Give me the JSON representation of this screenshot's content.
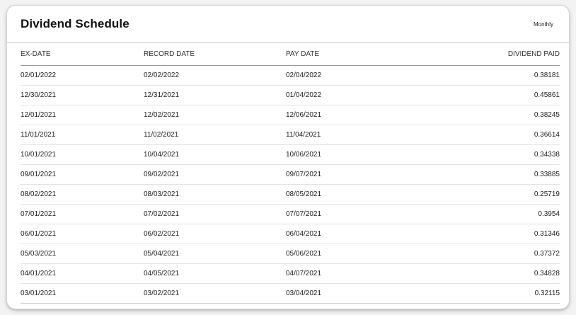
{
  "card": {
    "title": "Dividend Schedule",
    "frequency": "Monthly"
  },
  "table": {
    "headers": [
      "EX-DATE",
      "RECORD DATE",
      "PAY DATE",
      "DIVIDEND PAID"
    ],
    "rows": [
      [
        "02/01/2022",
        "02/02/2022",
        "02/04/2022",
        "0.38181"
      ],
      [
        "12/30/2021",
        "12/31/2021",
        "01/04/2022",
        "0.45861"
      ],
      [
        "12/01/2021",
        "12/02/2021",
        "12/06/2021",
        "0.38245"
      ],
      [
        "11/01/2021",
        "11/02/2021",
        "11/04/2021",
        "0.36614"
      ],
      [
        "10/01/2021",
        "10/04/2021",
        "10/06/2021",
        "0.34338"
      ],
      [
        "09/01/2021",
        "09/02/2021",
        "09/07/2021",
        "0.33885"
      ],
      [
        "08/02/2021",
        "08/03/2021",
        "08/05/2021",
        "0.25719"
      ],
      [
        "07/01/2021",
        "07/02/2021",
        "07/07/2021",
        "0.3954"
      ],
      [
        "06/01/2021",
        "06/02/2021",
        "06/04/2021",
        "0.31346"
      ],
      [
        "05/03/2021",
        "05/04/2021",
        "05/06/2021",
        "0.37372"
      ],
      [
        "04/01/2021",
        "04/05/2021",
        "04/07/2021",
        "0.34828"
      ],
      [
        "03/01/2021",
        "03/02/2021",
        "03/04/2021",
        "0.32115"
      ]
    ]
  }
}
